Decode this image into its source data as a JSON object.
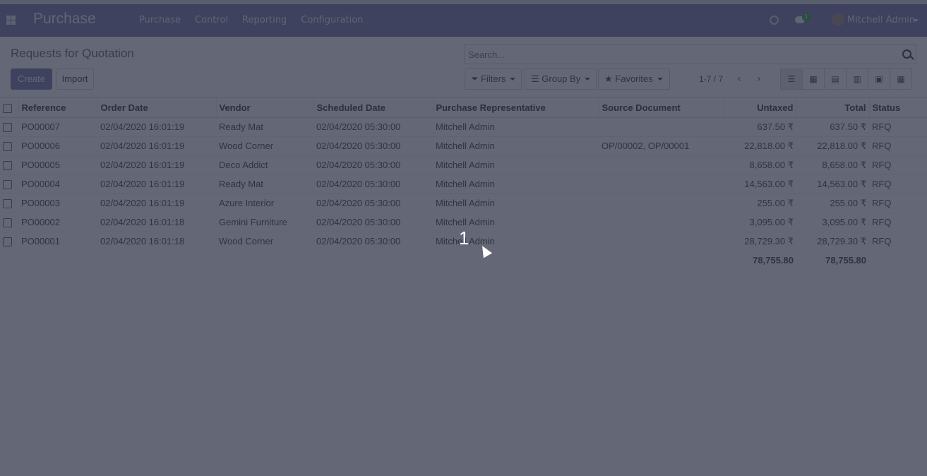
{
  "navbar": {
    "app_name": "Purchase",
    "menu": [
      "Purchase",
      "Control",
      "Reporting",
      "Configuration"
    ],
    "chat_badge": "1",
    "user_name": "Mitchell Admin",
    "icons": [
      "apps-icon",
      "activity-icon",
      "chat-icon",
      "avatar",
      "caret-down-icon"
    ]
  },
  "control": {
    "title": "Requests for Quotation",
    "create_label": "Create",
    "import_label": "Import",
    "search_placeholder": "Search...",
    "filters_label": "Filters",
    "group_by_label": "Group By",
    "favorites_label": "Favorites",
    "pager": "1-7 / 7",
    "views": [
      "list",
      "kanban",
      "pivot",
      "graph",
      "calendar",
      "activity"
    ]
  },
  "table": {
    "columns": [
      "Reference",
      "Order Date",
      "Vendor",
      "Scheduled Date",
      "Purchase Representative",
      "Source Document",
      "Untaxed",
      "Total",
      "Status"
    ],
    "rows": [
      {
        "ref": "PO00007",
        "order_date": "02/04/2020 16:01:19",
        "vendor": "Ready Mat",
        "scheduled": "02/04/2020 05:30:00",
        "rep": "Mitchell Admin",
        "source": "",
        "untaxed": "637.50 ₹",
        "total": "637.50 ₹",
        "status": "RFQ"
      },
      {
        "ref": "PO00006",
        "order_date": "02/04/2020 16:01:19",
        "vendor": "Wood Corner",
        "scheduled": "02/04/2020 05:30:00",
        "rep": "Mitchell Admin",
        "source": "OP/00002, OP/00001",
        "untaxed": "22,818.00 ₹",
        "total": "22,818.00 ₹",
        "status": "RFQ"
      },
      {
        "ref": "PO00005",
        "order_date": "02/04/2020 16:01:19",
        "vendor": "Deco Addict",
        "scheduled": "02/04/2020 05:30:00",
        "rep": "Mitchell Admin",
        "source": "",
        "untaxed": "8,658.00 ₹",
        "total": "8,658.00 ₹",
        "status": "RFQ"
      },
      {
        "ref": "PO00004",
        "order_date": "02/04/2020 16:01:19",
        "vendor": "Ready Mat",
        "scheduled": "02/04/2020 05:30:00",
        "rep": "Mitchell Admin",
        "source": "",
        "untaxed": "14,563.00 ₹",
        "total": "14,563.00 ₹",
        "status": "RFQ"
      },
      {
        "ref": "PO00003",
        "order_date": "02/04/2020 16:01:19",
        "vendor": "Azure Interior",
        "scheduled": "02/04/2020 05:30:00",
        "rep": "Mitchell Admin",
        "source": "",
        "untaxed": "255.00 ₹",
        "total": "255.00 ₹",
        "status": "RFQ"
      },
      {
        "ref": "PO00002",
        "order_date": "02/04/2020 16:01:18",
        "vendor": "Gemini Furniture",
        "scheduled": "02/04/2020 05:30:00",
        "rep": "Mitchell Admin",
        "source": "",
        "untaxed": "3,095.00 ₹",
        "total": "3,095.00 ₹",
        "status": "RFQ"
      },
      {
        "ref": "PO00001",
        "order_date": "02/04/2020 16:01:18",
        "vendor": "Wood Corner",
        "scheduled": "02/04/2020 05:30:00",
        "rep": "Mitchell Admin",
        "source": "",
        "untaxed": "28,729.30 ₹",
        "total": "28,729.30 ₹",
        "status": "RFQ"
      }
    ],
    "totals": {
      "untaxed": "78,755.80",
      "total": "78,755.80"
    }
  },
  "tour": {
    "step_number": "1"
  }
}
